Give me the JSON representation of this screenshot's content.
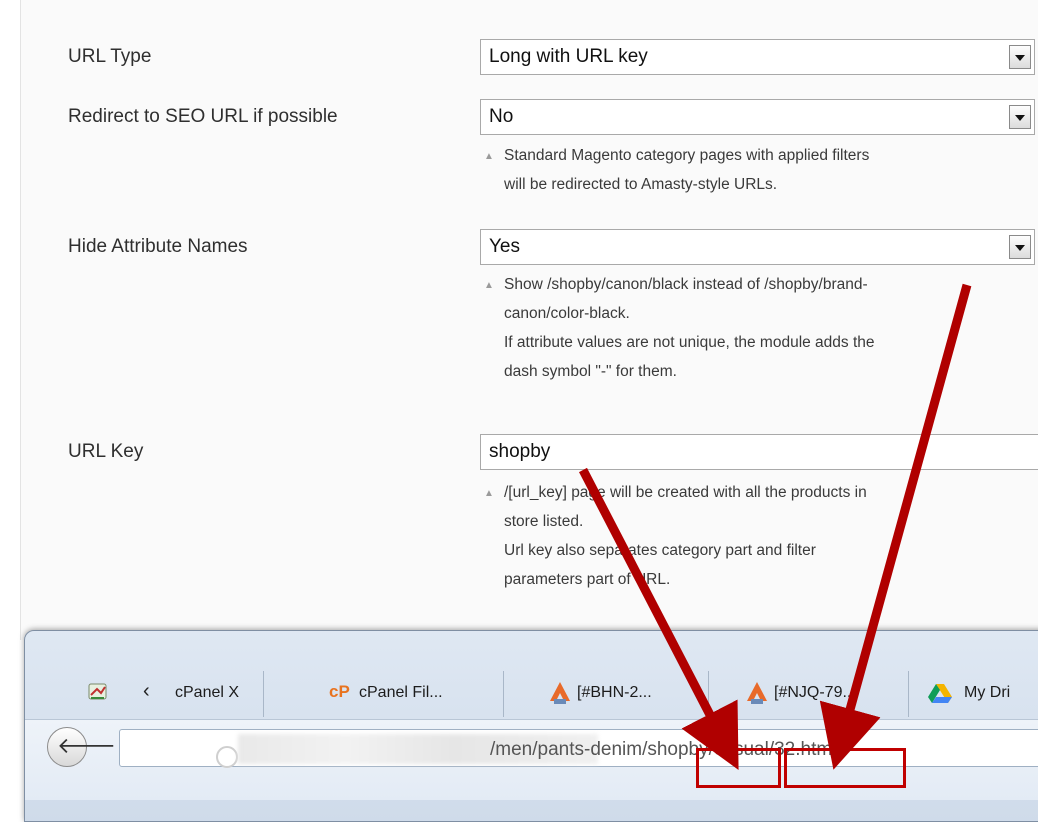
{
  "form": {
    "url_type": {
      "label": "URL Type",
      "value": "Long with URL key"
    },
    "redirect": {
      "label": "Redirect to SEO URL if possible",
      "value": "No",
      "note": [
        "Standard Magento category pages with applied filters",
        "will be redirected to Amasty-style URLs."
      ]
    },
    "hide_attr": {
      "label": "Hide Attribute Names",
      "value": "Yes",
      "note": [
        "Show /shopby/canon/black instead of /shopby/brand-",
        "canon/color-black.",
        "If attribute values are not unique, the module adds the",
        "dash symbol \"-\" for them."
      ]
    },
    "url_key": {
      "label": "URL Key",
      "value": "shopby",
      "note": [
        "/[url_key] page will be created with all the products in",
        "store listed.",
        "Url key also separates category part and filter",
        "parameters part of URL."
      ]
    }
  },
  "browser": {
    "tabs": [
      {
        "icon": "cpanel-icon",
        "label": "cPanel X"
      },
      {
        "icon": "cpanel-logo-icon",
        "badge": "cP",
        "label": "cPanel Fil..."
      },
      {
        "icon": "ticket-icon",
        "label": "[#BHN-2..."
      },
      {
        "icon": "ticket-icon",
        "label": "[#NJQ-79..."
      },
      {
        "icon": "google-drive-icon",
        "label": "My Dri"
      }
    ],
    "url_path": "/men/pants-denim/shopby/casual/32.html",
    "url_segments": {
      "pre": "/men/pants-denim/",
      "key": "shopby",
      "sep": "/",
      "rest": "casual/32.html"
    }
  },
  "colors": {
    "accent_arrow": "#b00000",
    "highlight_box": "#c00000"
  }
}
